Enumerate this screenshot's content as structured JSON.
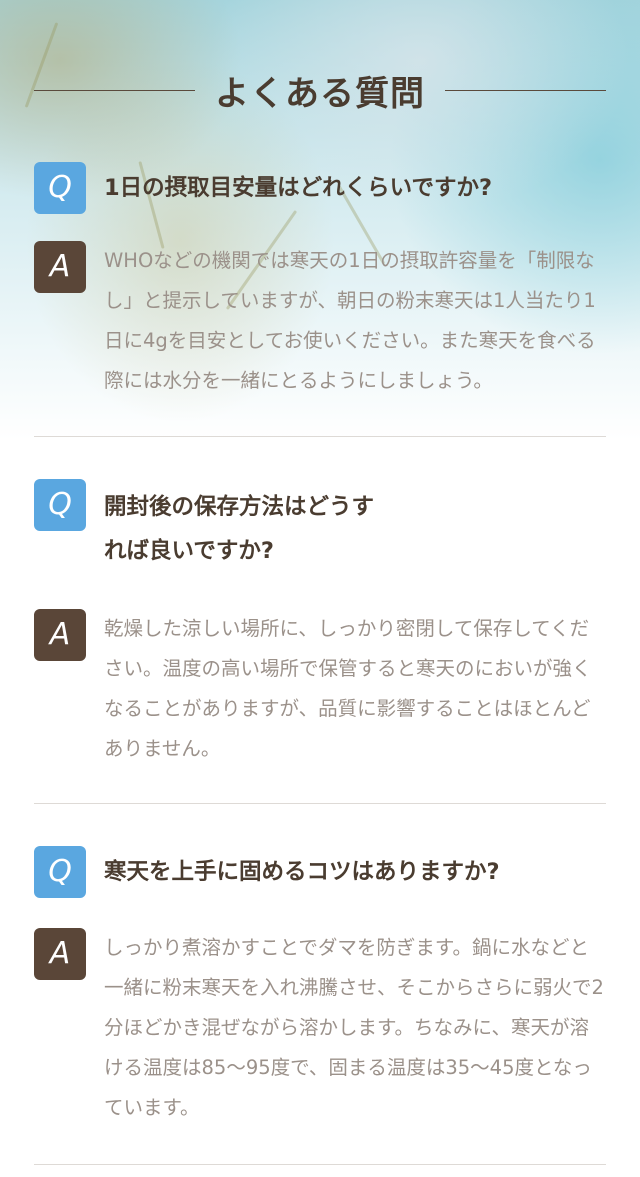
{
  "faq": {
    "title": "よくある質問",
    "items": [
      {
        "q_badge": "Q",
        "question": "1日の摂取目安量はどれくらいですか?",
        "a_badge": "A",
        "answer": "WHOなどの機関では寒天の1日の摂取許容量を「制限なし」と提示していますが、朝日の粉末寒天は1人当たり1日に4gを目安としてお使いください。また寒天を食べる際には水分を一緒にとるようにしましょう。"
      },
      {
        "q_badge": "Q",
        "question": "開封後の保存方法はどうすれば良いですか?",
        "a_badge": "A",
        "answer": "乾燥した涼しい場所に、しっかり密閉して保存してください。温度の高い場所で保管すると寒天のにおいが強くなることがありますが、品質に影響することはほとんどありません。"
      },
      {
        "q_badge": "Q",
        "question": "寒天を上手に固めるコツはありますか?",
        "a_badge": "A",
        "answer": "しっかり煮溶かすことでダマを防ぎます。鍋に水などと一緒に粉末寒天を入れ沸騰させ、そこからさらに弱火で2分ほどかき混ぜながら溶かします。ちなみに、寒天が溶ける温度は85～95度で、固まる温度は35～45度となっています。"
      }
    ]
  }
}
